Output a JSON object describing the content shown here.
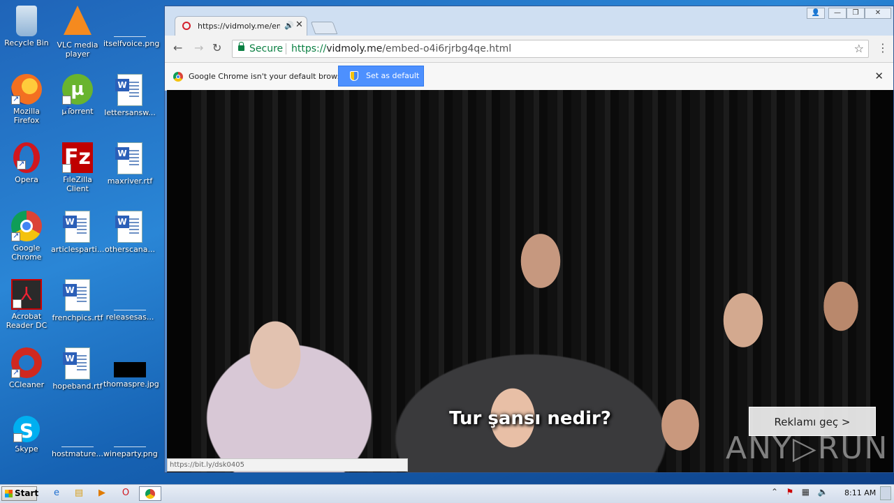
{
  "desktop": {
    "icons": [
      {
        "label": "Recycle Bin"
      },
      {
        "label": "VLC media player"
      },
      {
        "label": "itselfvoice.png"
      },
      {
        "label": "Mozilla Firefox"
      },
      {
        "label": "µTorrent"
      },
      {
        "label": "lettersansw..."
      },
      {
        "label": "Opera"
      },
      {
        "label": "FileZilla Client"
      },
      {
        "label": "maxriver.rtf"
      },
      {
        "label": "Google Chrome"
      },
      {
        "label": "articlesparti..."
      },
      {
        "label": "otherscana..."
      },
      {
        "label": "Acrobat Reader DC"
      },
      {
        "label": "frenchpics.rtf"
      },
      {
        "label": "releasesas..."
      },
      {
        "label": "CCleaner"
      },
      {
        "label": "hopeband.rtf"
      },
      {
        "label": "thomaspre.jpg"
      },
      {
        "label": "Skype"
      },
      {
        "label": "hostmature..."
      },
      {
        "label": "wineparty.png"
      }
    ]
  },
  "browser": {
    "tab_title": "https://vidmoly.me/emb",
    "omnibox": {
      "secure_label": "Secure",
      "url_scheme": "https://",
      "url_host": "vidmoly.me",
      "url_path": "/embed-o4i6rjrbg4qe.html"
    },
    "infobar": {
      "message": "Google Chrome isn't your default browser.",
      "button_label": "Set as default"
    },
    "video": {
      "subtitle": "Tur şansı nedir?",
      "skip_ad_label": "Reklamı geç >",
      "watermark": "ANY▷RUN"
    },
    "status_url": "https://bit.ly/dsk0405"
  },
  "taskbar": {
    "start_label": "Start",
    "clock": "8:11 AM"
  }
}
